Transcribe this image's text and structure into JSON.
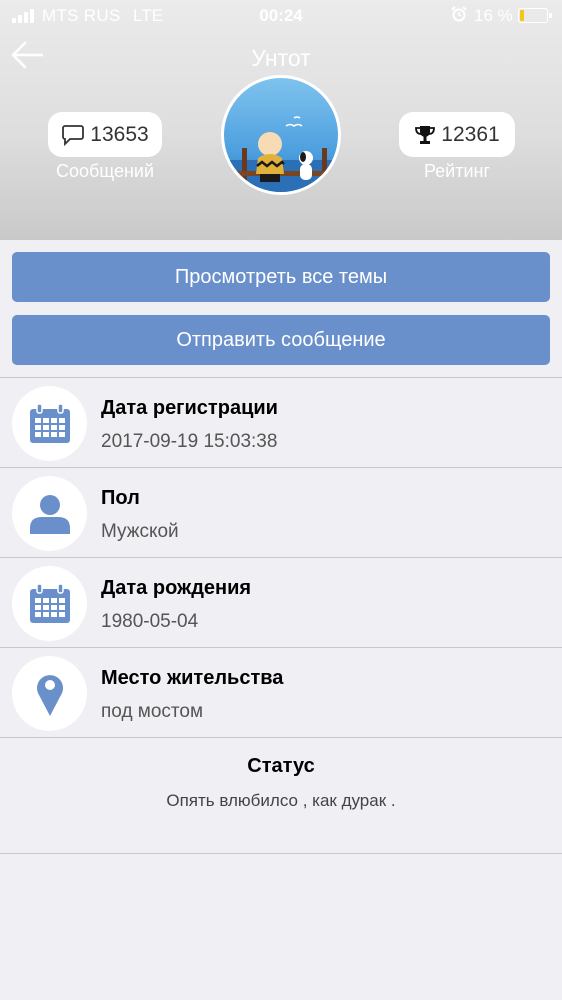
{
  "status_bar": {
    "carrier": "MTS RUS",
    "network": "LTE",
    "time": "00:24",
    "battery_text": "16 %",
    "battery_level": 0.16,
    "battery_color": "#f5c518"
  },
  "header": {
    "title": "Унтот",
    "messages_count": "13653",
    "messages_label": "Сообщений",
    "rating_count": "12361",
    "rating_label": "Рейтинг"
  },
  "actions": {
    "view_topics": "Просмотреть все темы",
    "send_message": "Отправить сообщение"
  },
  "info": [
    {
      "icon": "calendar-icon",
      "label": "Дата регистрации",
      "value": "2017-09-19 15:03:38"
    },
    {
      "icon": "person-icon",
      "label": "Пол",
      "value": "Мужской"
    },
    {
      "icon": "calendar-icon",
      "label": "Дата рождения",
      "value": "1980-05-04"
    },
    {
      "icon": "location-pin-icon",
      "label": "Место жительства",
      "value": "под мостом"
    }
  ],
  "status": {
    "title": "Статус",
    "text": "Опять влюбилсо , как дурак ."
  },
  "colors": {
    "accent": "#6a90cc",
    "icon": "#6a90cc",
    "background": "#efeff4"
  }
}
